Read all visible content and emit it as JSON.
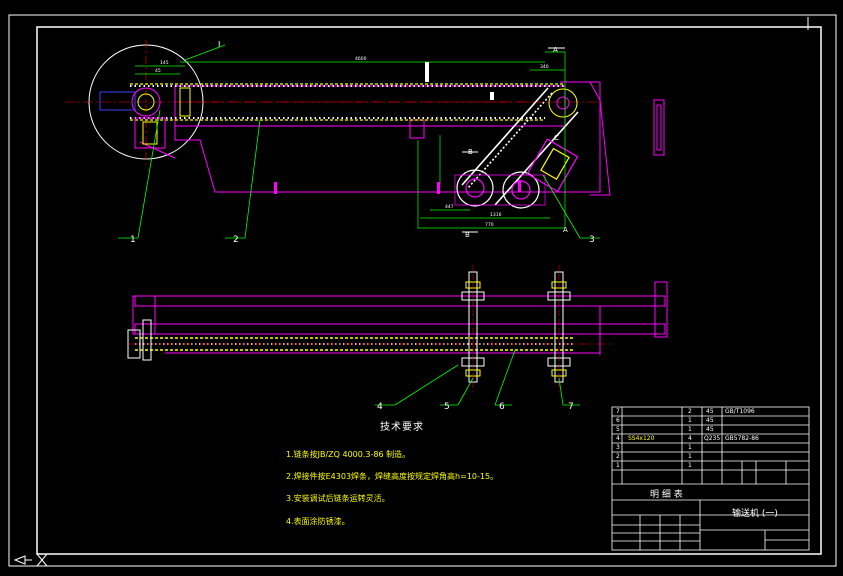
{
  "callouts": [
    "1",
    "2",
    "3",
    "4",
    "5",
    "6",
    "7"
  ],
  "section_marks": {
    "top": "I",
    "a_top": "A",
    "a_bot": "A",
    "b_top": "B",
    "b_bot": "B",
    "c": "C"
  },
  "tech_title": "技术要求",
  "requirements": [
    "1.链条按JB/ZQ 4000.3-86 制造。",
    "2.焊接件按E4303焊条，焊缝高度按规定焊角高h=10-15。",
    "3.安装调试后链条运转灵活。",
    "4.表面涂防锈漆。"
  ],
  "bom": {
    "rows": [
      {
        "no": "7",
        "qty": "2",
        "mat": "45",
        "std": "GB/T1096"
      },
      {
        "no": "6",
        "qty": "1",
        "mat": "45",
        "std": ""
      },
      {
        "no": "5",
        "qty": "1",
        "mat": "45",
        "std": ""
      },
      {
        "no": "4",
        "code": "SS4x120",
        "qty": "4",
        "mat": "Q235",
        "std": "GB5782-86"
      },
      {
        "no": "3",
        "qty": "1",
        "mat": "",
        "std": ""
      },
      {
        "no": "2",
        "qty": "1",
        "mat": "",
        "std": ""
      },
      {
        "no": "1",
        "qty": "1",
        "mat": "",
        "std": ""
      }
    ],
    "list_title": "明 细 表",
    "drawing_title": "输送机 (一)"
  },
  "colors": {
    "magenta": "#ff00ff",
    "yellow": "#ffff00",
    "green": "#00ff00",
    "blue": "#4040ff",
    "cyan": "#00ffff",
    "red": "#ff0000",
    "white": "#ffffff"
  }
}
